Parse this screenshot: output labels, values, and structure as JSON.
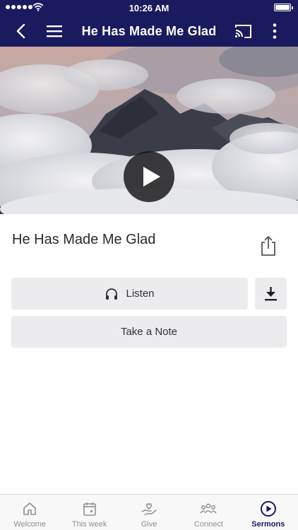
{
  "status_bar": {
    "time": "10:26 AM"
  },
  "nav": {
    "title": "He Has Made Me Glad",
    "back_icon": "chevron-left-icon",
    "menu_icon": "hamburger-icon",
    "cast_icon": "cast-icon",
    "more_icon": "vertical-dots-icon"
  },
  "player": {
    "play_icon": "play-icon"
  },
  "sermon": {
    "title": "He Has Made Me Glad",
    "share_icon": "share-icon",
    "listen_label": "Listen",
    "listen_icon": "headphones-icon",
    "download_icon": "download-icon",
    "note_label": "Take a Note"
  },
  "tabs": [
    {
      "label": "Welcome",
      "icon": "home-icon",
      "active": false
    },
    {
      "label": "This week",
      "icon": "calendar-icon",
      "active": false
    },
    {
      "label": "Give",
      "icon": "giving-hand-icon",
      "active": false
    },
    {
      "label": "Connect",
      "icon": "people-icon",
      "active": false
    },
    {
      "label": "Sermons",
      "icon": "play-circle-icon",
      "active": true
    }
  ],
  "colors": {
    "brand": "#1a1a5e",
    "button_bg": "#ececee",
    "tab_inactive": "#8f8f94"
  }
}
